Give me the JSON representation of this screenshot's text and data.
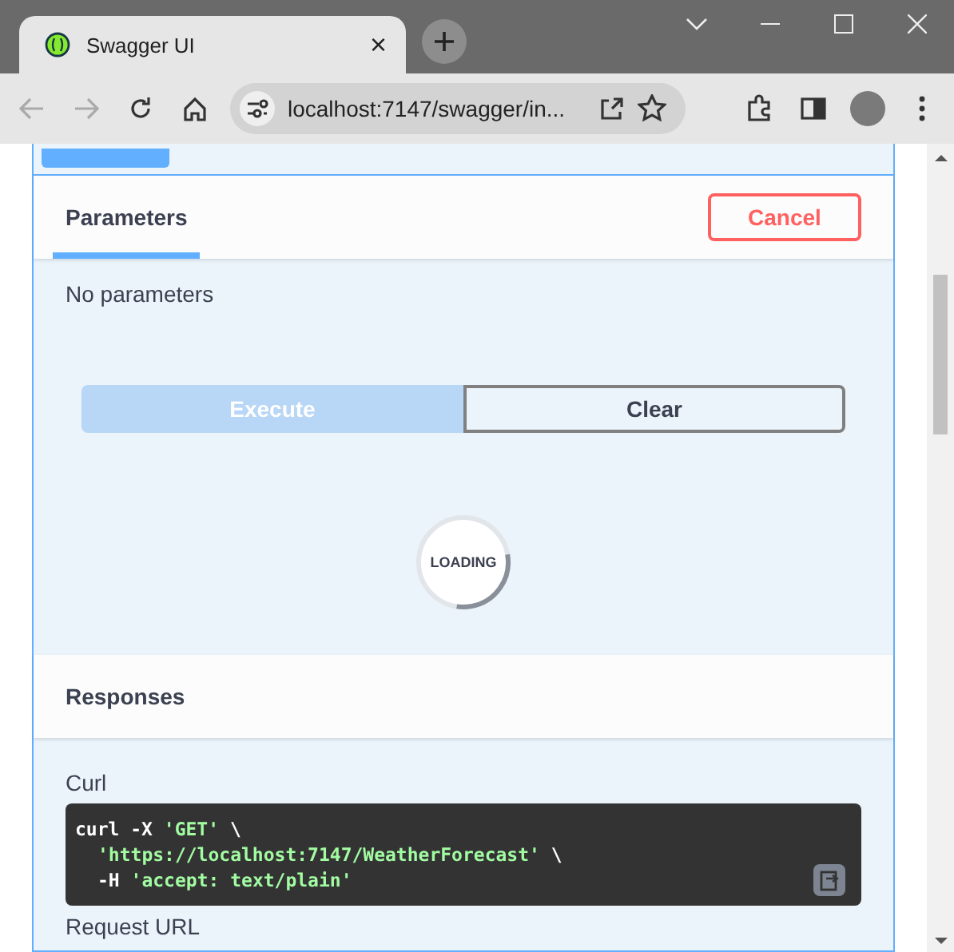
{
  "browser": {
    "tab_title": "Swagger UI",
    "tab_close": "×",
    "address": "localhost:7147/swagger/in..."
  },
  "operation": {
    "expanded": true
  },
  "parameters": {
    "tabs": [
      {
        "label": "Parameters",
        "selected": true
      }
    ],
    "cancel": "Cancel",
    "empty_text": "No parameters"
  },
  "actions": [
    {
      "label": "Execute",
      "disabled": true
    },
    {
      "label": "Clear",
      "disabled": false
    }
  ],
  "loading": {
    "label": "LOADING"
  },
  "responses": {
    "title": "Responses",
    "curl_label": "Curl",
    "curl_lines": [
      [
        {
          "kind": "cmd",
          "text": "curl -X "
        },
        {
          "kind": "str",
          "text": "'GET'"
        },
        {
          "kind": "cmd",
          "text": " \\"
        }
      ],
      [
        {
          "kind": "str",
          "text": "'https://localhost:7147/WeatherForecast'"
        },
        {
          "kind": "cmd",
          "text": " \\"
        }
      ],
      [
        {
          "kind": "cmd",
          "text": "-H "
        },
        {
          "kind": "str",
          "text": "'accept: text/plain'"
        }
      ]
    ],
    "request_url_label": "Request URL"
  }
}
